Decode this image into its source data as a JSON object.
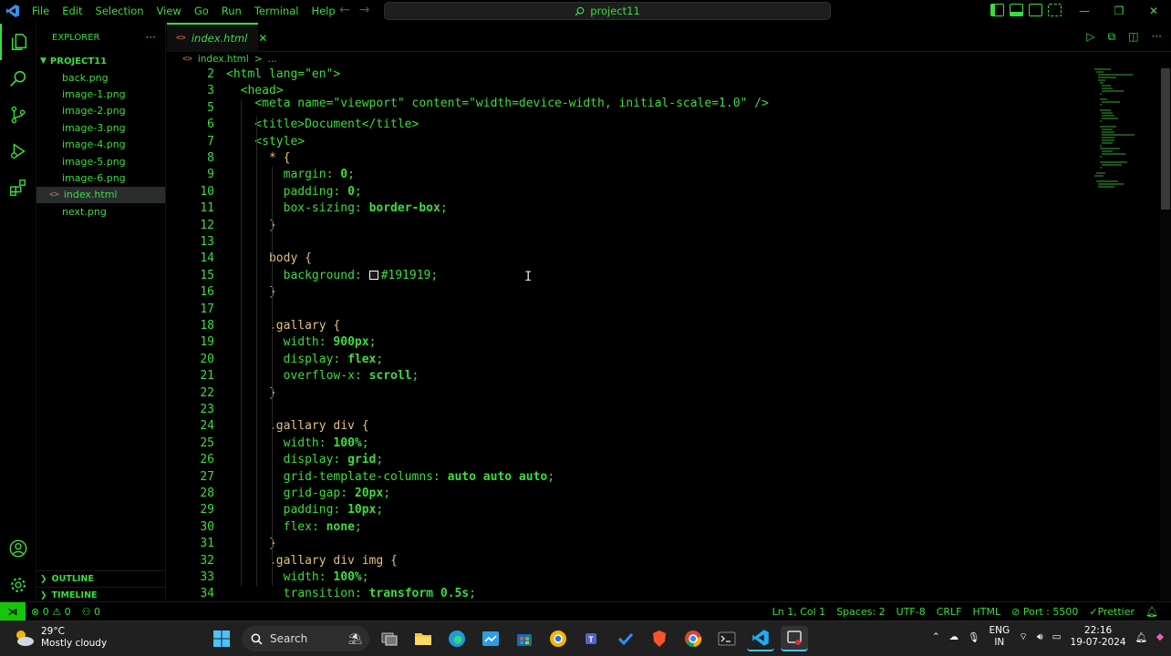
{
  "window": {
    "title": "project11"
  },
  "menu": [
    "File",
    "Edit",
    "Selection",
    "View",
    "Go",
    "Run",
    "Terminal",
    "Help"
  ],
  "sidebar": {
    "header": "EXPLORER",
    "more": "···",
    "project": "PROJECT11",
    "files": [
      "back.png",
      "image-1.png",
      "image-2.png",
      "image-3.png",
      "image-4.png",
      "image-5.png",
      "image-6.png",
      "index.html",
      "next.png"
    ],
    "outline": "OUTLINE",
    "timeline": "TIMELINE"
  },
  "tab": {
    "label": "index.html"
  },
  "breadcrumb": {
    "file": "index.html",
    "sep": ">",
    "more": "..."
  },
  "code": [
    {
      "n": "2",
      "t": "<html lang=\"en\">"
    },
    {
      "n": "3",
      "t": "  <head>"
    },
    {
      "n": "5",
      "t": "    <meta name=\"viewport\" content=\"width=device-width, initial-scale=1.0\" />"
    },
    {
      "n": "6",
      "t": "    <title>Document</title>"
    },
    {
      "n": "7",
      "t": "    <style>"
    },
    {
      "n": "8",
      "t": "      * {"
    },
    {
      "n": "9",
      "t": "        margin: 0;"
    },
    {
      "n": "10",
      "t": "        padding: 0;"
    },
    {
      "n": "11",
      "t": "        box-sizing: border-box;"
    },
    {
      "n": "12",
      "t": "      }"
    },
    {
      "n": "13",
      "t": ""
    },
    {
      "n": "14",
      "t": "      body {"
    },
    {
      "n": "15",
      "t": "        background: #191919;"
    },
    {
      "n": "16",
      "t": "      }"
    },
    {
      "n": "17",
      "t": ""
    },
    {
      "n": "18",
      "t": "      .gallary {"
    },
    {
      "n": "19",
      "t": "        width: 900px;"
    },
    {
      "n": "20",
      "t": "        display: flex;"
    },
    {
      "n": "21",
      "t": "        overflow-x: scroll;"
    },
    {
      "n": "22",
      "t": "      }"
    },
    {
      "n": "23",
      "t": ""
    },
    {
      "n": "24",
      "t": "      .gallary div {"
    },
    {
      "n": "25",
      "t": "        width: 100%;"
    },
    {
      "n": "26",
      "t": "        display: grid;"
    },
    {
      "n": "27",
      "t": "        grid-template-columns: auto auto auto;"
    },
    {
      "n": "28",
      "t": "        grid-gap: 20px;"
    },
    {
      "n": "29",
      "t": "        padding: 10px;"
    },
    {
      "n": "30",
      "t": "        flex: none;"
    },
    {
      "n": "31",
      "t": "      }"
    },
    {
      "n": "32",
      "t": "      .gallary div img {"
    },
    {
      "n": "33",
      "t": "        width: 100%;"
    },
    {
      "n": "34",
      "t": "        transition: transform 0.5s;"
    }
  ],
  "status": {
    "errors": "0",
    "warnings": "0",
    "ports": "0",
    "position": "Ln 1, Col 1",
    "spaces": "Spaces: 2",
    "encoding": "UTF-8",
    "eol": "CRLF",
    "language": "HTML",
    "port": "Port : 5500",
    "prettier": "Prettier"
  },
  "taskbar": {
    "temp": "29°C",
    "weather": "Mostly cloudy",
    "search": "Search",
    "lang1": "ENG",
    "lang2": "IN",
    "time": "22:16",
    "date": "19-07-2024"
  }
}
